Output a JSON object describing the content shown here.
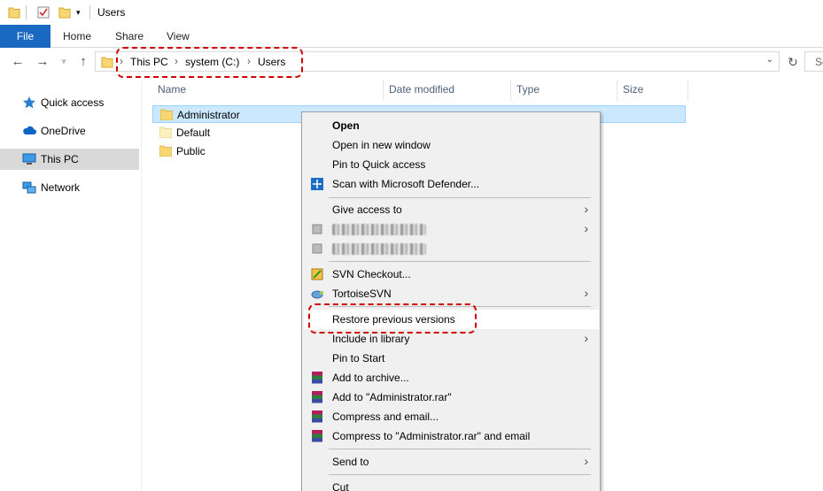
{
  "window": {
    "title": "Users"
  },
  "ribbon": {
    "tabs": [
      "File",
      "Home",
      "Share",
      "View"
    ]
  },
  "address": {
    "crumbs": [
      "This PC",
      "system (C:)",
      "Users"
    ],
    "search_placeholder": "Se"
  },
  "sidebar": {
    "items": [
      {
        "label": "Quick access",
        "icon": "star-icon"
      },
      {
        "label": "OneDrive",
        "icon": "cloud-icon"
      },
      {
        "label": "This PC",
        "icon": "monitor-icon",
        "selected": true
      },
      {
        "label": "Network",
        "icon": "network-icon"
      }
    ]
  },
  "columns": [
    "Name",
    "Date modified",
    "Type",
    "Size"
  ],
  "files": [
    {
      "name": "Administrator",
      "date": "",
      "type": "",
      "selected": true
    },
    {
      "name": "Default",
      "date": "",
      "type": ""
    },
    {
      "name": "Public",
      "date": "",
      "type": ""
    }
  ],
  "context_menu": {
    "items": [
      {
        "label": "Open",
        "bold": true
      },
      {
        "label": "Open in new window"
      },
      {
        "label": "Pin to Quick access"
      },
      {
        "label": "Scan with Microsoft Defender...",
        "icon": "defender-icon"
      },
      {
        "label": "Give access to",
        "submenu": true
      },
      {
        "label": "",
        "blurred": true,
        "submenu": true
      },
      {
        "label": "",
        "blurred": true
      },
      {
        "label": "SVN Checkout...",
        "icon": "svn-checkout-icon"
      },
      {
        "label": "TortoiseSVN",
        "icon": "tortoisesvn-icon",
        "submenu": true
      },
      {
        "label": "Restore previous versions"
      },
      {
        "label": "Include in library",
        "submenu": true
      },
      {
        "label": "Pin to Start"
      },
      {
        "label": "Add to archive...",
        "icon": "winrar-icon"
      },
      {
        "label": "Add to \"Administrator.rar\"",
        "icon": "winrar-icon"
      },
      {
        "label": "Compress and email...",
        "icon": "winrar-icon"
      },
      {
        "label": "Compress to \"Administrator.rar\" and email",
        "icon": "winrar-icon"
      },
      {
        "label": "Send to",
        "submenu": true
      },
      {
        "label": "Cut"
      }
    ]
  },
  "colors": {
    "accent": "#1969c2",
    "highlight": "#d10000",
    "selection": "#cce8ff"
  }
}
